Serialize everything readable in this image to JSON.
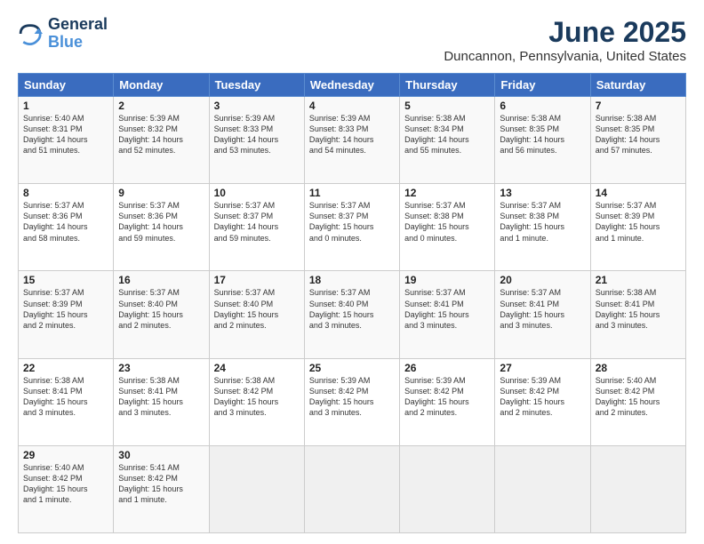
{
  "header": {
    "logo_line1": "General",
    "logo_line2": "Blue",
    "title": "June 2025",
    "subtitle": "Duncannon, Pennsylvania, United States"
  },
  "days_of_week": [
    "Sunday",
    "Monday",
    "Tuesday",
    "Wednesday",
    "Thursday",
    "Friday",
    "Saturday"
  ],
  "weeks": [
    [
      {
        "num": "1",
        "rise": "5:40 AM",
        "set": "8:31 PM",
        "hours": "14 hours",
        "mins": "51 minutes"
      },
      {
        "num": "2",
        "rise": "5:39 AM",
        "set": "8:32 PM",
        "hours": "14 hours",
        "mins": "52 minutes"
      },
      {
        "num": "3",
        "rise": "5:39 AM",
        "set": "8:33 PM",
        "hours": "14 hours",
        "mins": "53 minutes"
      },
      {
        "num": "4",
        "rise": "5:39 AM",
        "set": "8:33 PM",
        "hours": "14 hours",
        "mins": "54 minutes"
      },
      {
        "num": "5",
        "rise": "5:38 AM",
        "set": "8:34 PM",
        "hours": "14 hours",
        "mins": "55 minutes"
      },
      {
        "num": "6",
        "rise": "5:38 AM",
        "set": "8:35 PM",
        "hours": "14 hours",
        "mins": "56 minutes"
      },
      {
        "num": "7",
        "rise": "5:38 AM",
        "set": "8:35 PM",
        "hours": "14 hours",
        "mins": "57 minutes"
      }
    ],
    [
      {
        "num": "8",
        "rise": "5:37 AM",
        "set": "8:36 PM",
        "hours": "14 hours",
        "mins": "58 minutes"
      },
      {
        "num": "9",
        "rise": "5:37 AM",
        "set": "8:36 PM",
        "hours": "14 hours",
        "mins": "59 minutes"
      },
      {
        "num": "10",
        "rise": "5:37 AM",
        "set": "8:37 PM",
        "hours": "14 hours",
        "mins": "59 minutes"
      },
      {
        "num": "11",
        "rise": "5:37 AM",
        "set": "8:37 PM",
        "hours": "15 hours",
        "mins": "0 minutes"
      },
      {
        "num": "12",
        "rise": "5:37 AM",
        "set": "8:38 PM",
        "hours": "15 hours",
        "mins": "0 minutes"
      },
      {
        "num": "13",
        "rise": "5:37 AM",
        "set": "8:38 PM",
        "hours": "15 hours",
        "mins": "1 minute"
      },
      {
        "num": "14",
        "rise": "5:37 AM",
        "set": "8:39 PM",
        "hours": "15 hours",
        "mins": "1 minute"
      }
    ],
    [
      {
        "num": "15",
        "rise": "5:37 AM",
        "set": "8:39 PM",
        "hours": "15 hours",
        "mins": "2 minutes"
      },
      {
        "num": "16",
        "rise": "5:37 AM",
        "set": "8:40 PM",
        "hours": "15 hours",
        "mins": "2 minutes"
      },
      {
        "num": "17",
        "rise": "5:37 AM",
        "set": "8:40 PM",
        "hours": "15 hours",
        "mins": "2 minutes"
      },
      {
        "num": "18",
        "rise": "5:37 AM",
        "set": "8:40 PM",
        "hours": "15 hours",
        "mins": "3 minutes"
      },
      {
        "num": "19",
        "rise": "5:37 AM",
        "set": "8:41 PM",
        "hours": "15 hours",
        "mins": "3 minutes"
      },
      {
        "num": "20",
        "rise": "5:37 AM",
        "set": "8:41 PM",
        "hours": "15 hours",
        "mins": "3 minutes"
      },
      {
        "num": "21",
        "rise": "5:38 AM",
        "set": "8:41 PM",
        "hours": "15 hours",
        "mins": "3 minutes"
      }
    ],
    [
      {
        "num": "22",
        "rise": "5:38 AM",
        "set": "8:41 PM",
        "hours": "15 hours",
        "mins": "3 minutes"
      },
      {
        "num": "23",
        "rise": "5:38 AM",
        "set": "8:41 PM",
        "hours": "15 hours",
        "mins": "3 minutes"
      },
      {
        "num": "24",
        "rise": "5:38 AM",
        "set": "8:42 PM",
        "hours": "15 hours",
        "mins": "3 minutes"
      },
      {
        "num": "25",
        "rise": "5:39 AM",
        "set": "8:42 PM",
        "hours": "15 hours",
        "mins": "3 minutes"
      },
      {
        "num": "26",
        "rise": "5:39 AM",
        "set": "8:42 PM",
        "hours": "15 hours",
        "mins": "2 minutes"
      },
      {
        "num": "27",
        "rise": "5:39 AM",
        "set": "8:42 PM",
        "hours": "15 hours",
        "mins": "2 minutes"
      },
      {
        "num": "28",
        "rise": "5:40 AM",
        "set": "8:42 PM",
        "hours": "15 hours",
        "mins": "2 minutes"
      }
    ],
    [
      {
        "num": "29",
        "rise": "5:40 AM",
        "set": "8:42 PM",
        "hours": "15 hours",
        "mins": "1 minute"
      },
      {
        "num": "30",
        "rise": "5:41 AM",
        "set": "8:42 PM",
        "hours": "15 hours",
        "mins": "1 minute"
      },
      null,
      null,
      null,
      null,
      null
    ]
  ]
}
